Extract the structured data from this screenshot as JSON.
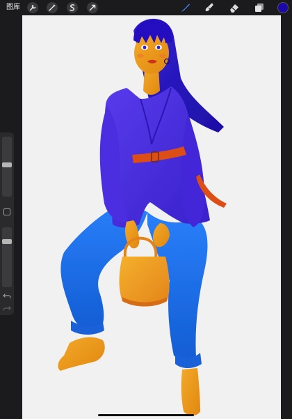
{
  "app": {
    "gallery_label": "图库"
  },
  "toolbar": {
    "left_tools": [
      "actions-wrench-icon",
      "adjustments-wand-icon",
      "selection-s-icon",
      "transform-arrow-icon"
    ],
    "right_tools": [
      "brush-icon",
      "smudge-icon",
      "eraser-icon",
      "layers-icon"
    ],
    "active_tool": "brush-icon",
    "active_color": "#1a08a8",
    "active_tint": "#3f8cff"
  },
  "sidebar": {
    "brush_size_level": 0.45,
    "opacity_level": 0.2,
    "controls": [
      "modify-square-icon",
      "undo-icon",
      "redo-icon"
    ]
  },
  "artwork": {
    "palette": {
      "hair": "#2e1bd0",
      "jacket": "#4a2fe2",
      "jeans": "#1b6ff0",
      "skin": "#f5a11f",
      "belt": "#e05018",
      "bag": "#f49b1c"
    }
  }
}
